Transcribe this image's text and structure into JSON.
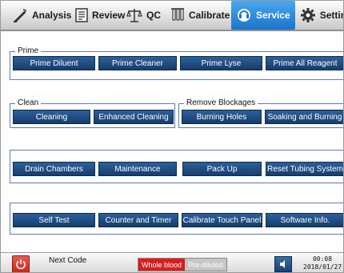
{
  "nav": {
    "tabs": [
      {
        "label": "Analysis",
        "icon": "analysis-icon"
      },
      {
        "label": "Review",
        "icon": "review-icon"
      },
      {
        "label": "QC",
        "icon": "qc-icon"
      },
      {
        "label": "Calibrate",
        "icon": "calibrate-icon"
      },
      {
        "label": "Service",
        "icon": "service-icon",
        "active": true
      },
      {
        "label": "Settings",
        "icon": "settings-icon"
      }
    ]
  },
  "groups": {
    "prime": {
      "legend": "Prime",
      "buttons": [
        "Prime Diluent",
        "Prime Cleaner",
        "Prime Lyse",
        "Prime All Reagent"
      ]
    },
    "clean": {
      "legend": "Clean",
      "buttons": [
        "Cleaning",
        "Enhanced Cleaning"
      ]
    },
    "remove_blockages": {
      "legend": "Remove Blockages",
      "buttons": [
        "Burning Holes",
        "Soaking and Burning"
      ]
    },
    "maintenance_row": {
      "buttons": [
        "Drain Chambers",
        "Maintenance",
        "Pack Up",
        "Reset Tubing System"
      ]
    },
    "tools_row": {
      "buttons": [
        "Self Test",
        "Counter and Timer",
        "Calibrate Touch Panel",
        "Software Info."
      ]
    }
  },
  "bottom": {
    "next_code_label": "Next Code",
    "mode_whole_blood": "Whole blood",
    "mode_prediluted": "Pre-diluted",
    "time": "00:08",
    "date": "2018/01/27"
  },
  "colors": {
    "active_tab": "#1a73c9",
    "button": "#1f4c80",
    "group_border": "#5f78b0",
    "whole_blood": "#d81e1e",
    "power": "#d8352a"
  }
}
